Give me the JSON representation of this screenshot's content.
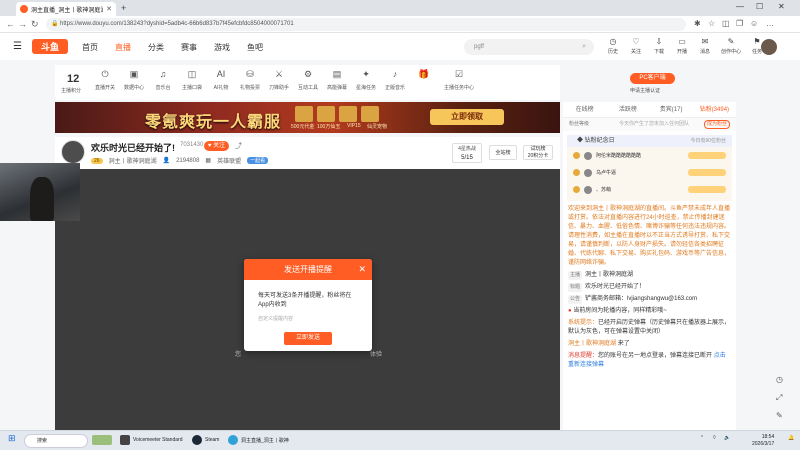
{
  "browser": {
    "tab_title": "洞主直播_洞主丨歌神洞庭湖",
    "url": "https://www.douyu.com/138243?dyshid=5adb4c-66b6d837b7f45efcbfdc8504000071701",
    "new_tab": "+",
    "minimize": "—",
    "maximize": "☐",
    "close": "✕"
  },
  "header": {
    "logo": "斗鱼",
    "nav": [
      "首页",
      "直播",
      "分类",
      "赛事",
      "游戏",
      "鱼吧"
    ],
    "search_placeholder": "pgff",
    "icons": [
      {
        "label": "历史",
        "icon": "history-icon",
        "glyph": "◷"
      },
      {
        "label": "关注",
        "icon": "heart-icon",
        "glyph": "♡"
      },
      {
        "label": "下载",
        "icon": "download-icon",
        "glyph": "⇩"
      },
      {
        "label": "开播",
        "icon": "broadcast-icon",
        "glyph": "▭"
      },
      {
        "label": "消息",
        "icon": "message-icon",
        "glyph": "✉"
      },
      {
        "label": "创作中心",
        "icon": "create-icon",
        "glyph": "✎"
      },
      {
        "label": "任务",
        "icon": "task-icon",
        "glyph": "⚑"
      }
    ]
  },
  "infobar": {
    "level": "12",
    "level_label": "主播积分",
    "functions": [
      {
        "label": "直播开关",
        "glyph": "⏻"
      },
      {
        "label": "数据中心",
        "glyph": "▣"
      },
      {
        "label": "音乐台",
        "glyph": "♫"
      },
      {
        "label": "主播口袋",
        "glyph": "◫"
      },
      {
        "label": "AI礼物",
        "glyph": "AI"
      },
      {
        "label": "礼物投票",
        "glyph": "⛁"
      },
      {
        "label": "刀锋助手",
        "glyph": "⚔"
      },
      {
        "label": "互动工具",
        "glyph": "⚙"
      },
      {
        "label": "高能弹幕",
        "glyph": "▤"
      },
      {
        "label": "星海任务",
        "glyph": "✦"
      },
      {
        "label": "正版音乐",
        "glyph": "♪"
      },
      {
        "label": "",
        "glyph": "🎁"
      },
      {
        "label": "主播任务中心",
        "glyph": "☑"
      }
    ],
    "pc_button": "PC客户端",
    "anchor_task": "申请主播认证"
  },
  "banner": {
    "headline": "零氪爽玩一人霸服",
    "button": "立即领取",
    "captions": [
      "500元代金",
      "100万仙玉",
      "VIP15",
      "仙灵宠物"
    ]
  },
  "room": {
    "title": "欢乐时光已经开始了!",
    "room_id": "7031430",
    "follow": "关注",
    "level_badge": "26",
    "streamer": "洞主丨歌神洞庭湖",
    "viewers": "2194808",
    "category": "英雄联盟",
    "tag": "一起看",
    "hot_label": "4星热战",
    "hot_value": "5/15",
    "btn_full": "全站榜",
    "btn_try": "试玩榜",
    "btn_try2": "20积分卡"
  },
  "player": {
    "left_text": "您",
    "right_text": "体验"
  },
  "modal": {
    "title": "发送开播提醒",
    "close": "✕",
    "message": "每天可发送3条开播提醒，粉丝将在App内收到",
    "input_placeholder": "自定义提醒内容",
    "submit": "立即发送"
  },
  "right_panel": {
    "tabs": [
      "在线榜",
      "活跃榜",
      "贵宾(17)",
      "钻粉(3494)"
    ],
    "fan_row_left": "粉丝等级",
    "fan_row_mid": "今天你产生了您未加入任何团队",
    "fan_row_cta": "成为粉丝",
    "rank_title": "钻粉纪念日",
    "rank_sub": "今日有90位粉丝",
    "rank_rows": [
      "阿伦米酷酷酷酷酷酷",
      "乌卢牛逼",
      "、苏萌"
    ],
    "chat": {
      "welcome": "欢迎来到洞主丨歌神洞庭湖的直播间。斗鱼严禁未成年人直播或打赏。依法对直播内容进行24小时巡查，禁止传播封建迷信、暴力、血腥、低俗色情、赌博诈骗等任何违法违规内容。请理性消费，如主播在直播时以不正当方式诱导打赏、私下交易，请谨慎判断，以防人身财产损失。请勿轻信各类招聘征婚、代练代聊、私下交易、购买礼包码、游戏币等广告信息，谨防网络诈骗。",
      "line1_label": "主播",
      "line1": "洞主丨歌神洞庭湖",
      "line2_label": "标题",
      "line2": "欢乐时光已经开始了！",
      "line3_label": "公告",
      "line3": "铲酱商务邮箱：lvjiangshangwu@163.com",
      "notice": "当前房间为轮播内容，同样精彩哦~",
      "sys_label": "系统提示：",
      "sys_text": "已经开启历史弹幕（历史弹幕只在播放器上展示，默认为灰色，可在弹幕设置中关闭）",
      "join_user": "洞主丨歌神洞庭湖",
      "join_text": "来了",
      "msg_label": "消息提醒：",
      "msg_text": "您的账号在另一地点登录，弹幕连接已断开",
      "msg_link": "点击重新连接弹幕"
    }
  },
  "taskbar": {
    "search": "搜索",
    "items": [
      "Voicemeeter Standard",
      "Steam",
      "洞主直播_洞主丨歌神"
    ],
    "time": "18:54",
    "date": "2026/3/17"
  },
  "colors": {
    "brand": "#ff5d23",
    "panel_bg": "#ffffff",
    "player_bg": "#3c3c3c"
  }
}
